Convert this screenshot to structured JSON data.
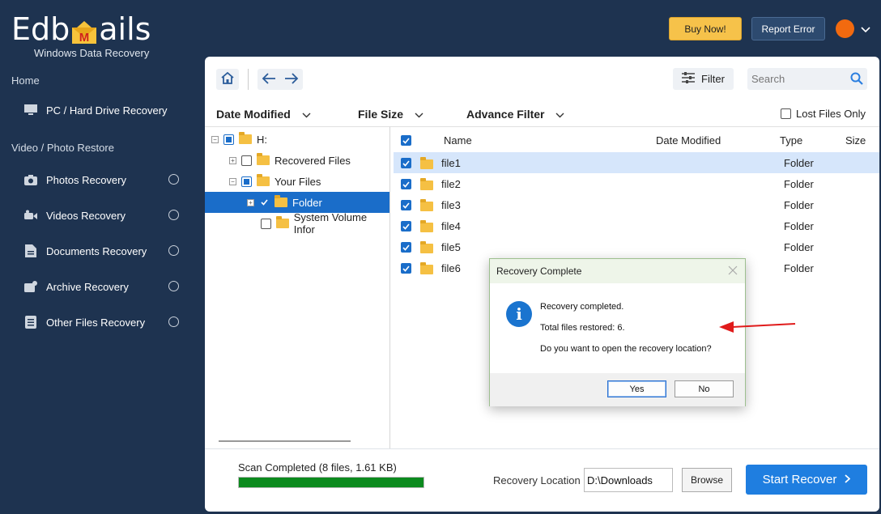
{
  "app": {
    "logo_left": "Edb",
    "logo_right": "ails",
    "logo_emblem_letter": "M",
    "subtitle": "Windows Data Recovery"
  },
  "sidebar": {
    "home_section": "Home",
    "home_items": [
      {
        "label": "PC / Hard Drive Recovery",
        "icon": "monitor-icon"
      }
    ],
    "media_section": "Video / Photo Restore",
    "media_items": [
      {
        "label": "Photos Recovery",
        "icon": "camera-icon"
      },
      {
        "label": "Videos Recovery",
        "icon": "video-camera-icon"
      },
      {
        "label": "Documents Recovery",
        "icon": "document-icon"
      },
      {
        "label": "Archive Recovery",
        "icon": "archive-icon"
      },
      {
        "label": "Other Files Recovery",
        "icon": "list-icon"
      }
    ]
  },
  "header": {
    "buy_label": "Buy Now!",
    "report_label": "Report Error"
  },
  "toolbar": {
    "filter_label": "Filter",
    "search_placeholder": "Search"
  },
  "filters": {
    "date_modified": "Date Modified",
    "file_size": "File Size",
    "advance_filter": "Advance Filter",
    "lost_files_only": "Lost Files Only"
  },
  "tree": {
    "root": "H:",
    "recovered_files": "Recovered Files",
    "your_files": "Your Files",
    "folder": "Folder",
    "system_volume": "System Volume Infor"
  },
  "grid": {
    "columns": {
      "name": "Name",
      "date_modified": "Date Modified",
      "type": "Type",
      "size": "Size"
    },
    "rows": [
      {
        "name": "file1",
        "type": "Folder"
      },
      {
        "name": "file2",
        "type": "Folder"
      },
      {
        "name": "file3",
        "type": "Folder"
      },
      {
        "name": "file4",
        "type": "Folder"
      },
      {
        "name": "file5",
        "type": "Folder"
      },
      {
        "name": "file6",
        "type": "Folder"
      }
    ]
  },
  "status": {
    "scan_text": "Scan Completed (8 files, 1.61 KB)",
    "progress_fraction": 1.0,
    "progress_color": "#0c8a1e",
    "recovery_location_label": "Recovery Location",
    "recovery_location_value": "D:\\Downloads",
    "browse_label": "Browse",
    "start_label": "Start Recover"
  },
  "dialog": {
    "title": "Recovery Complete",
    "line1": "Recovery completed.",
    "line2": "Total files restored: 6.",
    "line3": "Do you want to open the recovery location?",
    "yes_label": "Yes",
    "no_label": "No",
    "icon": "info-icon"
  },
  "colors": {
    "sidebar_bg": "#1e3350",
    "accent": "#1f7ee0",
    "buy_bg": "#f6c24a",
    "selection": "#1a6dc9",
    "annotation_arrow": "#e01b1b"
  }
}
